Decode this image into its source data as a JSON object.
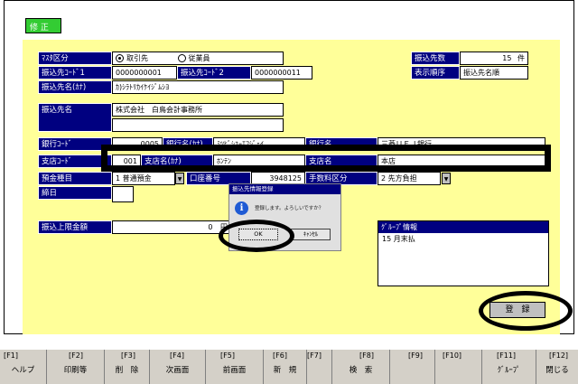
{
  "screen_title": "修 正",
  "master_type": {
    "label": "ﾏｽﾀ区分",
    "option_1": "取引先",
    "option_2": "従業員"
  },
  "transfer_count": {
    "label": "振込先数",
    "value": "15",
    "unit": "件"
  },
  "display_order": {
    "label": "表示順序",
    "value": "振込先名順"
  },
  "transfer_code_1": {
    "label": "振込先ｺｰﾄﾞ1",
    "value": "0000000001"
  },
  "transfer_code_2": {
    "label": "振込先ｺｰﾄﾞ2",
    "value": "0000000011"
  },
  "transfer_name_kana": {
    "label": "振込先名(ｶﾅ)",
    "value": "ｶ)ｼﾗﾄﾘｶｲｹｲｼﾞﾑｼﾖ"
  },
  "transfer_name": {
    "label": "振込先名",
    "value": "株式会社　白鳥会計事務所"
  },
  "bank": {
    "code_label": "銀行ｺｰﾄﾞ",
    "code_value": "0005",
    "kana_label": "銀行名(ｶﾅ)",
    "kana_value": "ﾐﾂﾋﾞｼﾕｰｴﾌｼﾞｪｲ",
    "name_label": "銀行名",
    "name_value": "三菱ＵＦＪ銀行"
  },
  "branch": {
    "code_label": "支店ｺｰﾄﾞ",
    "code_value": "001",
    "kana_label": "支店名(ｶﾅ)",
    "kana_value": "ﾎﾝﾃﾝ",
    "name_label": "支店名",
    "name_value": "本店"
  },
  "deposit_type": {
    "label": "預金種目",
    "value": "1 普通預金"
  },
  "account_number": {
    "label": "口座番号",
    "value": "3948125"
  },
  "fee_type": {
    "label": "手数料区分",
    "value": "2 先方負担"
  },
  "closing_day": {
    "label": "締日",
    "value": ""
  },
  "transfer_limit": {
    "label": "振込上限金額",
    "value": "0",
    "unit": "円"
  },
  "group_info": {
    "label": "ｸﾞﾙｰﾌﾟ情報",
    "value": "15 月末払"
  },
  "dialog": {
    "title": "振込先情報登録",
    "message": "登録します。よろしいですか？",
    "ok_label": "OK",
    "cancel_label": "ｷｬﾝｾﾙ",
    "icon": "info-icon"
  },
  "register_label": "登　録",
  "fkeys": [
    {
      "key": "[F1]",
      "label": "ヘルプ"
    },
    {
      "key": "[F2]",
      "label": "印刷等"
    },
    {
      "key": "[F3]",
      "label": "削　除"
    },
    {
      "key": "[F4]",
      "label": "次画面"
    },
    {
      "key": "[F5]",
      "label": "前画面"
    },
    {
      "key": "[F6]",
      "label": "新　規"
    },
    {
      "key": "[F7]",
      "label": ""
    },
    {
      "key": "[F8]",
      "label": "検　索"
    },
    {
      "key": "[F9]",
      "label": ""
    },
    {
      "key": "[F10]",
      "label": ""
    },
    {
      "key": "[F11]",
      "label": "ｸﾞﾙｰﾌﾟ"
    },
    {
      "key": "[F12]",
      "label": "閉じる"
    }
  ],
  "colors": {
    "label_bg": "#000080",
    "panel_bg": "#ffff99",
    "title_bg": "#33cc33",
    "annotation": "#000000"
  }
}
